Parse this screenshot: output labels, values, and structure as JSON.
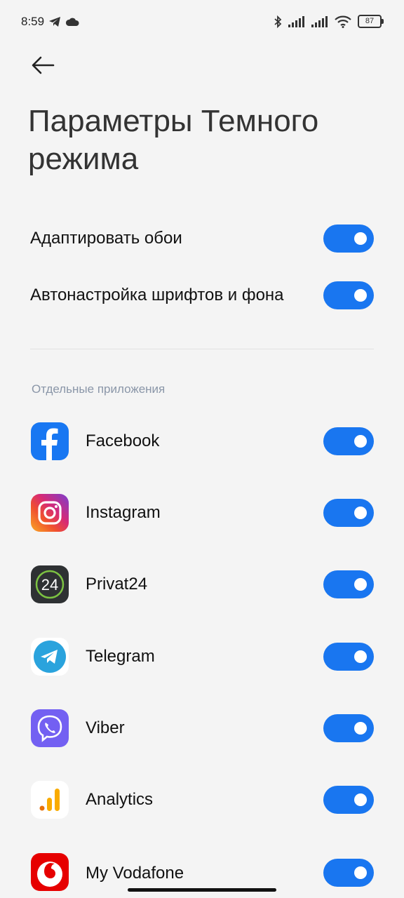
{
  "status_bar": {
    "time": "8:59",
    "battery": "87",
    "icons": [
      "telegram-icon",
      "cloud-icon",
      "bluetooth-icon",
      "signal-icon",
      "signal-icon",
      "wifi-icon",
      "battery-icon"
    ]
  },
  "header": {
    "back_icon": "arrow-left-icon",
    "title": "Параметры Темного режима"
  },
  "settings": [
    {
      "label": "Адаптировать обои",
      "enabled": true
    },
    {
      "label": "Автонастройка шрифтов и фона",
      "enabled": true
    }
  ],
  "apps_section": {
    "header": "Отдельные приложения",
    "apps": [
      {
        "name": "Facebook",
        "icon": "facebook-icon",
        "enabled": true
      },
      {
        "name": "Instagram",
        "icon": "instagram-icon",
        "enabled": true
      },
      {
        "name": "Privat24",
        "icon": "privat24-icon",
        "enabled": true
      },
      {
        "name": "Telegram",
        "icon": "telegram-icon",
        "enabled": true
      },
      {
        "name": "Viber",
        "icon": "viber-icon",
        "enabled": true
      },
      {
        "name": "Analytics",
        "icon": "analytics-icon",
        "enabled": true
      },
      {
        "name": "My Vodafone",
        "icon": "vodafone-icon",
        "enabled": true
      }
    ]
  },
  "colors": {
    "toggle_on": "#1976f0",
    "background": "#f4f4f4",
    "section_header": "#8a96a8"
  }
}
